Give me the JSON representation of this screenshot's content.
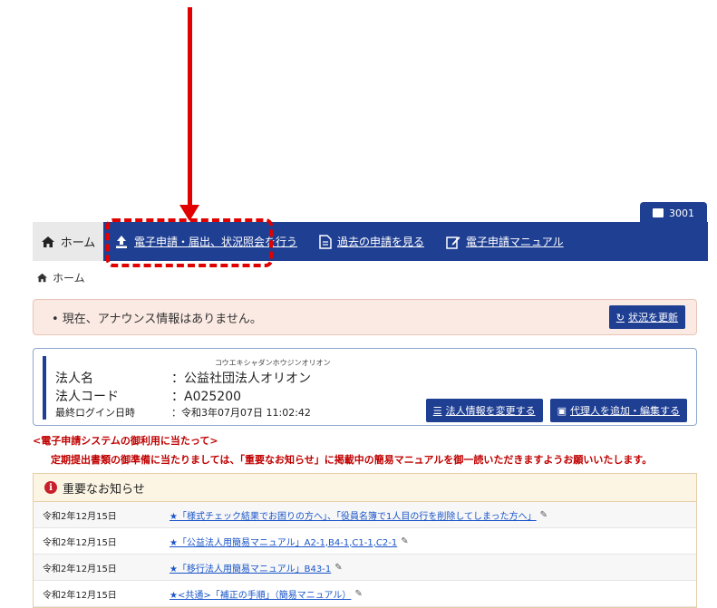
{
  "user_tab": {
    "label": "3001"
  },
  "nav": {
    "home": "ホーム",
    "items": [
      {
        "label": "電子申請・届出、状況照会を行う",
        "icon": "upload-icon"
      },
      {
        "label": "過去の申請を見る",
        "icon": "document-icon"
      },
      {
        "label": "電子申請マニュアル",
        "icon": "edit-icon"
      }
    ]
  },
  "breadcrumb": {
    "home": "ホーム"
  },
  "announce": {
    "message": "• 現在、アナウンス情報はありません。",
    "refresh_label": "状況を更新"
  },
  "corp": {
    "kana": "コウエキシャダンホウジンオリオン",
    "name_label": "法人名",
    "name_value": "：公益社団法人オリオン",
    "code_label": "法人コード",
    "code_value": "：A025200",
    "login_label": "最終ログイン日時",
    "login_value": "：令和3年07月07日 11:02:42",
    "change_button": "法人情報を変更する",
    "agent_button": "代理人を追加・編集する"
  },
  "notice": {
    "title": "<電子申請システムの御利用に当たって>",
    "body": "定期提出書類の御準備に当たりましては、「重要なお知らせ」に掲載中の簡易マニュアルを御一読いただきますようお願いいたします。"
  },
  "news": {
    "header": "重要なお知らせ",
    "rows": [
      {
        "date": "令和2年12月15日",
        "title": "★「様式チェック結果でお困りの方へ」、「役員名簿で1人目の行を削除してしまった方へ」"
      },
      {
        "date": "令和2年12月15日",
        "title": "★「公益法人用簡易マニュアル」A2-1,B4-1,C1-1,C2-1"
      },
      {
        "date": "令和2年12月15日",
        "title": "★「移行法人用簡易マニュアル」B43-1"
      },
      {
        "date": "令和2年12月15日",
        "title": "★<共通>「補正の手順」（簡易マニュアル）"
      }
    ]
  },
  "colors": {
    "nav_bg": "#1f3f93",
    "annotation": "#e00000",
    "notice_text": "#c00000",
    "link": "#1a55c9"
  }
}
